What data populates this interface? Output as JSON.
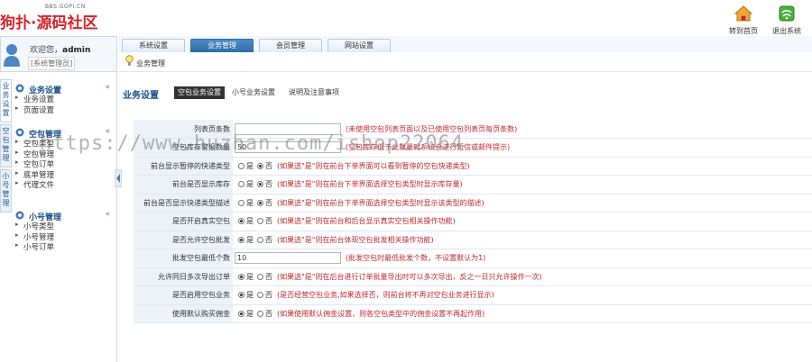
{
  "logo": {
    "small": "BBS.GOPI.CN",
    "text": "狗扑·源码社区"
  },
  "header_buttons": {
    "home": "转到首页",
    "logout": "退出系统"
  },
  "user": {
    "welcome": "欢迎您，",
    "name": "admin",
    "role": "[系统管理员]"
  },
  "tabs": [
    "系统设置",
    "业务管理",
    "会员管理",
    "网站设置"
  ],
  "breadcrumb": "业务管理",
  "vtabs": [
    "业务设置",
    "空包管理",
    "小号管理"
  ],
  "sidebar": {
    "groups": [
      {
        "title": "业务设置",
        "items": [
          "业务设置",
          "页面设置"
        ]
      },
      {
        "title": "空包管理",
        "items": [
          "空包类型",
          "空包管理",
          "空包订单",
          "底单管理",
          "代理文件"
        ]
      },
      {
        "title": "小号管理",
        "items": [
          "小号类型",
          "小号管理",
          "小号订单"
        ]
      }
    ]
  },
  "main": {
    "title": "业务设置",
    "subtabs": [
      "空包业务设置",
      "小号业务设置",
      "说明及注意事项"
    ]
  },
  "form": {
    "radio_yes": "是",
    "radio_no": "否",
    "rows": [
      {
        "label": "列表页条数",
        "type": "input",
        "value": "",
        "hint": "(未使用空包列表页面以及已使用空包列表页每页条数)"
      },
      {
        "label": "空包库存警报数量",
        "type": "input",
        "value": "50",
        "hint": "(空包库存低于此数量时系统会进行短信或邮件提示)"
      },
      {
        "label": "前台显示暂停的快递类型",
        "type": "radio",
        "checked": "no",
        "hint": "(如果选\"是\"则在前台下单界面可以看到暂停的空包快递类型)"
      },
      {
        "label": "前台是否显示库存",
        "type": "radio",
        "checked": "no",
        "hint": "(如果选\"是\"则在前台下单界面选择空包类型时显示库存量)"
      },
      {
        "label": "前台是否显示快递类型描述",
        "type": "radio",
        "checked": "no",
        "hint": "(如果选\"是\"则在前台下单界面选择空包类型时显示该类型的描述)"
      },
      {
        "label": "是否开启真实空包",
        "type": "radio",
        "checked": "yes",
        "hint": "(如果选\"是\"则在前台和后台显示真实空包相关操作功能)"
      },
      {
        "label": "是否允许空包批发",
        "type": "radio",
        "checked": "yes",
        "hint": "(如果选\"是\"则在前台体现空包批发相关操作功能)"
      },
      {
        "label": "批发空包最低个数",
        "type": "input",
        "value": "10",
        "hint": "(批发空包时最低批发个数，不设置默认为1)"
      },
      {
        "label": "允许同日多次导出订单",
        "type": "radio",
        "checked": "yes",
        "hint": "(如果选\"是\"则在后台进行订单批量导出时可以多次导出，反之一日只允许操作一次)"
      },
      {
        "label": "是否启用空包业务",
        "type": "radio",
        "checked": "yes",
        "hint": "(是否经营空包业务,如果选择否，则前台将不再对空包业务进行显示)"
      },
      {
        "label": "使用默认购买佣金",
        "type": "radio",
        "checked": "yes",
        "hint": "(如果使用默认佣金设置，则各空包类型中的佣金设置不再起作用)"
      }
    ]
  },
  "watermark": "https://www.huzhan.com/ishop22064",
  "colors": {
    "accent": "#1a4f8b",
    "hint": "#c0282d",
    "tab_active": "#2f6aa8",
    "logo": "#d9222a"
  }
}
